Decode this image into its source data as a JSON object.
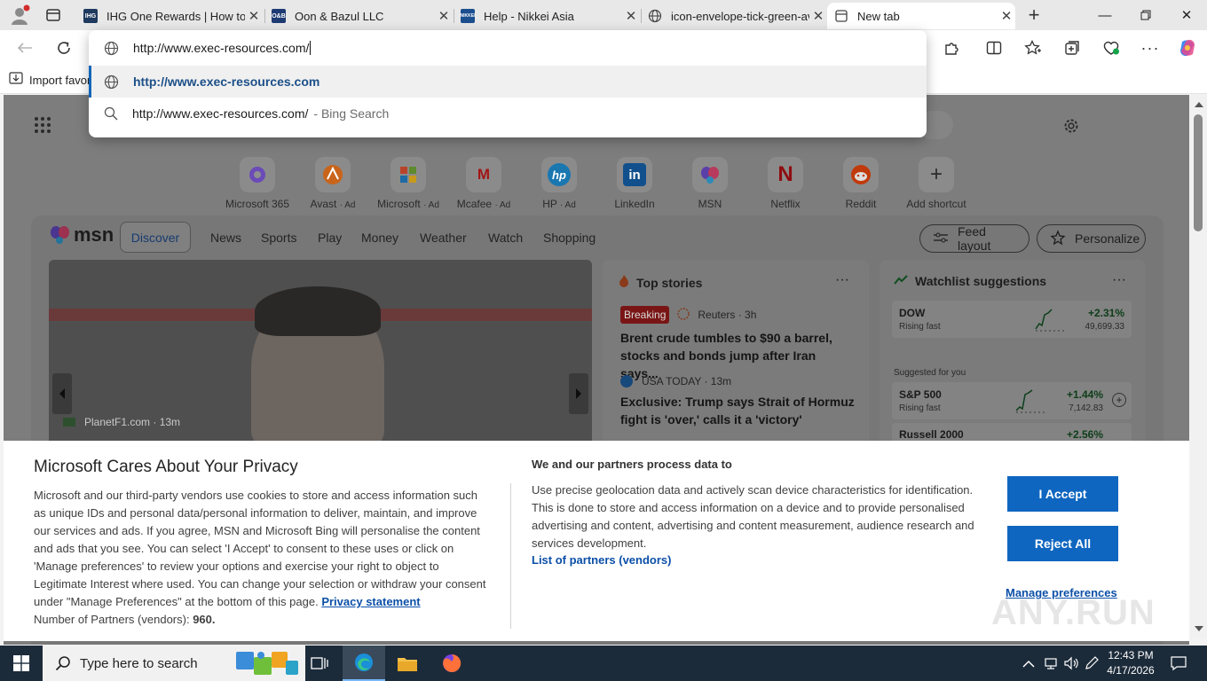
{
  "browser": {
    "tabs": [
      {
        "title": "IHG One Rewards | How to k",
        "favicon_text": "IHG",
        "favicon_color": "#1e3a5f"
      },
      {
        "title": "Oon & Bazul LLC",
        "favicon_text": "O&B",
        "favicon_color": "#1f3b73"
      },
      {
        "title": "Help - Nikkei Asia",
        "favicon_text": "NIKKEI",
        "favicon_color": "#1b4f8f"
      },
      {
        "title": "icon-envelope-tick-green-av",
        "favicon_text": "",
        "favicon_color": ""
      },
      {
        "title": "New tab",
        "favicon_text": "",
        "favicon_color": ""
      }
    ],
    "address_value": "http://www.exec-resources.com/",
    "suggestions": [
      {
        "text": "http://www.exec-resources.com",
        "suffix": ""
      },
      {
        "text": "http://www.exec-resources.com/",
        "suffix": "- Bing Search"
      }
    ],
    "favorites_import": "Import favor"
  },
  "ntp": {
    "shortcuts": [
      {
        "label": "Microsoft 365",
        "ad": "",
        "glyph": "",
        "color": "#7a4bd1"
      },
      {
        "label": "Avast",
        "ad": "· Ad",
        "glyph": "",
        "color": "#f07a1c"
      },
      {
        "label": "Microsoft",
        "ad": "· Ad",
        "glyph": "",
        "color": "#5c8f3a"
      },
      {
        "label": "Mcafee",
        "ad": "· Ad",
        "glyph": "M",
        "color": "#c01818"
      },
      {
        "label": "HP",
        "ad": "· Ad",
        "glyph": "hp",
        "color": "#0096d6"
      },
      {
        "label": "LinkedIn",
        "ad": "",
        "glyph": "in",
        "color": "#0a66c2"
      },
      {
        "label": "MSN",
        "ad": "",
        "glyph": "",
        "color": "#6d45c4"
      },
      {
        "label": "Netflix",
        "ad": "",
        "glyph": "N",
        "color": "#b20710"
      },
      {
        "label": "Reddit",
        "ad": "",
        "glyph": "",
        "color": "#ff4500"
      },
      {
        "label": "Add shortcut",
        "ad": "",
        "glyph": "+",
        "color": "#8b8b8b"
      }
    ],
    "msn": {
      "brand": "msn",
      "nav": [
        "Discover",
        "News",
        "Sports",
        "Play",
        "Money",
        "Weather",
        "Watch",
        "Shopping"
      ],
      "feed_layout": "Feed layout",
      "personalize": "Personalize",
      "hero_source": "PlanetF1.com · 13m",
      "top_stories": {
        "title": "Top stories",
        "items": [
          {
            "badge": "Breaking",
            "source": "Reuters · 3h",
            "headline": "Brent crude tumbles to $90 a barrel, stocks and bonds jump after Iran says..."
          },
          {
            "badge": "",
            "source": "USA TODAY · 13m",
            "headline": "Exclusive: Trump says Strait of Hormuz fight is 'over,' calls it a 'victory'"
          }
        ]
      },
      "watchlist": {
        "title": "Watchlist suggestions",
        "top": {
          "name": "DOW",
          "sub": "Rising fast",
          "change": "+2.31%",
          "value": "49,699.33"
        },
        "suggested_label": "Suggested for you",
        "items": [
          {
            "name": "S&P 500",
            "sub": "Rising fast",
            "change": "+1.44%",
            "value": "7,142.83"
          },
          {
            "name": "Russell 2000",
            "sub": "",
            "change": "+2.56%",
            "value": ""
          }
        ]
      }
    }
  },
  "consent": {
    "title": "Microsoft Cares About Your Privacy",
    "body": "Microsoft and our third-party vendors use cookies to store and access information such as unique IDs and personal data/personal information to deliver, maintain, and improve our services and ads. If you agree, MSN and Microsoft Bing will personalise the content and ads that you see. You can select 'I Accept' to consent to these uses or click on 'Manage preferences' to review your options and exercise your right to object to Legitimate Interest where used. You can change your selection or withdraw your consent under \"Manage Preferences\" at the bottom of this page.",
    "privacy_link": "Privacy statement",
    "partners_label": "Number of Partners (vendors):",
    "partners_count": "960.",
    "right_title": "We and our partners process data to",
    "right_body": "Use precise geolocation data and actively scan device characteristics for identification. This is done to store and access information on a device and to provide personalised advertising and content, advertising and content measurement, audience research and services development.",
    "partners_link": "List of partners (vendors)",
    "accept": "I Accept",
    "reject": "Reject All",
    "manage": "Manage preferences"
  },
  "taskbar": {
    "search_placeholder": "Type here to search",
    "time": "12:43 PM",
    "date": "4/17/2026"
  },
  "watermark": "ANY.RUN"
}
